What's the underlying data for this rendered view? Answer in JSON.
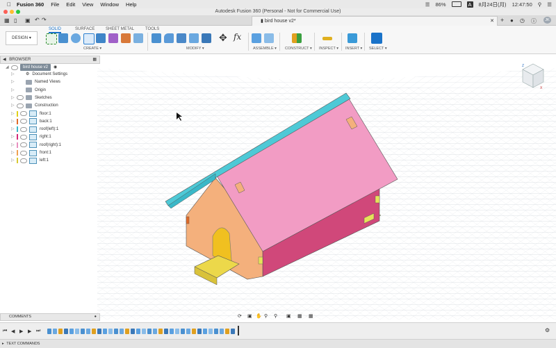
{
  "menubar": {
    "app_name": "Fusion 360",
    "menus": [
      "File",
      "Edit",
      "View",
      "Window",
      "Help"
    ],
    "battery": "86%",
    "input_mode": "A",
    "date": "8月24日(月)",
    "time": "12:47:50"
  },
  "window": {
    "title": "Autodesk Fusion 360 (Personal - Not for Commercial Use)",
    "doc_tab": "bird house v2*",
    "avatar_initials": "JK"
  },
  "ribbon": {
    "workspace": "DESIGN",
    "tabs": [
      "SOLID",
      "SURFACE",
      "SHEET METAL",
      "TOOLS"
    ],
    "active_tab": "SOLID",
    "groups": [
      "CREATE",
      "MODIFY",
      "ASSEMBLE",
      "CONSTRUCT",
      "INSPECT",
      "INSERT",
      "SELECT"
    ]
  },
  "browser": {
    "title": "BROWSER",
    "root": "bird house v2",
    "items": [
      {
        "label": "Document Settings",
        "kind": "settings"
      },
      {
        "label": "Named Views",
        "kind": "folder"
      },
      {
        "label": "Origin",
        "kind": "folder"
      },
      {
        "label": "Sketches",
        "kind": "folder"
      },
      {
        "label": "Construction",
        "kind": "folder"
      },
      {
        "label": "floor:1",
        "kind": "component",
        "color": "#e0d018"
      },
      {
        "label": "back:1",
        "kind": "component",
        "color": "#e06a28"
      },
      {
        "label": "roof(left):1",
        "kind": "component",
        "color": "#3ab8c8"
      },
      {
        "label": "right:1",
        "kind": "component",
        "color": "#d42a78"
      },
      {
        "label": "roof(right):1",
        "kind": "component",
        "color": "#e890c0"
      },
      {
        "label": "front:1",
        "kind": "component",
        "color": "#f0a050"
      },
      {
        "label": "left:1",
        "kind": "component",
        "color": "#d8c830"
      }
    ]
  },
  "bottom": {
    "comments": "COMMENTS",
    "text_commands": "TEXT COMMANDS"
  },
  "colors": {
    "accent": "#1a73c9",
    "roof_left": "#4ec9d6",
    "roof_right": "#f29cc4",
    "right_wall": "#d0487a",
    "front": "#f4b07c",
    "floor": "#e6e35a"
  }
}
